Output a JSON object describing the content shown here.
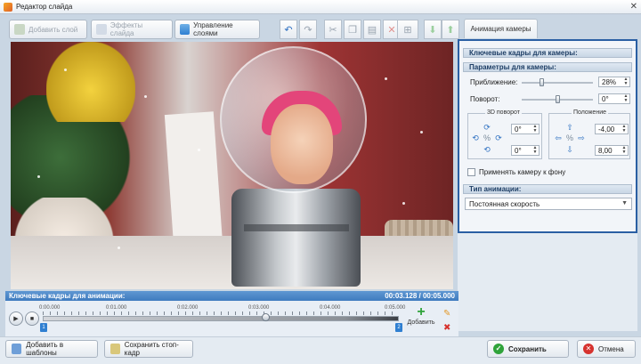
{
  "window": {
    "title": "Редактор слайда"
  },
  "toolbar": {
    "add_layer": "Добавить слой",
    "slide_effects": "Эффекты слайда",
    "manage_layers": "Управление слоями"
  },
  "right_panel": {
    "tab_label": "Анимация камеры",
    "keyframes_header": "Ключевые кадры для камеры:",
    "params_header": "Параметры для камеры:",
    "zoom_label": "Приближение:",
    "zoom_value": "28%",
    "rotation_label": "Поворот:",
    "rotation_value": "0°",
    "rotate3d_title": "3D поворот",
    "rotate3d_x": "0°",
    "rotate3d_y": "0°",
    "position_title": "Положение",
    "position_x": "-4,00",
    "position_y": "8,00",
    "apply_bg_label": "Применять камеру к фону",
    "anim_type_header": "Тип анимации:",
    "anim_type_value": "Постоянная скорость"
  },
  "timeline": {
    "header": "Ключевые кадры для анимации:",
    "time_display": "00:03.128 / 00:05.000",
    "ticks": [
      "0:00.000",
      "0:01.000",
      "0:02.000",
      "0:03.000",
      "0:04.000",
      "0:05.000"
    ],
    "playhead_fraction": 0.626,
    "keyframe_1": "1",
    "keyframe_2": "2",
    "add_label": "Добавить"
  },
  "bottom": {
    "add_to_templates": "Добавить в шаблоны",
    "save_frame": "Сохранить стоп-кадр",
    "save": "Сохранить",
    "cancel": "Отмена"
  },
  "colors": {
    "accent_blue": "#2a5fa3",
    "timeline_header": "#4a86c8",
    "save_icon": "#2fa33a",
    "cancel_icon": "#d6322e"
  },
  "icons": [
    "undo-icon",
    "redo-icon",
    "cut-icon",
    "copy-icon",
    "paste-icon",
    "delete-icon",
    "grid-icon",
    "move-down-icon",
    "move-up-icon",
    "play-icon",
    "stop-icon",
    "add-icon",
    "pencil-icon",
    "remove-icon",
    "checkmark-icon",
    "close-icon"
  ]
}
